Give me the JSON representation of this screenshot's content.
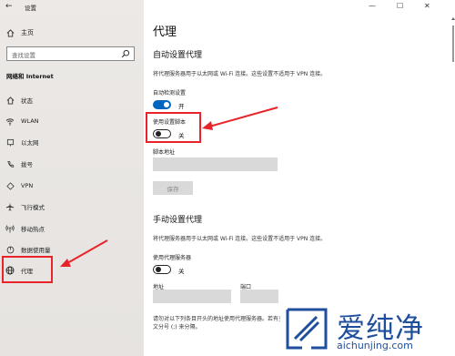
{
  "window": {
    "title": "设置",
    "minimize": "—",
    "maximize": "☐",
    "close": "✕"
  },
  "sidebar": {
    "home": "主页",
    "search_placeholder": "查找设置",
    "section": "网络和 Internet",
    "items": [
      {
        "label": "状态",
        "icon": "status-house-icon"
      },
      {
        "label": "WLAN",
        "icon": "wifi-icon"
      },
      {
        "label": "以太网",
        "icon": "ethernet-icon"
      },
      {
        "label": "拨号",
        "icon": "dialup-phone-icon"
      },
      {
        "label": "VPN",
        "icon": "vpn-icon"
      },
      {
        "label": "飞行模式",
        "icon": "airplane-icon"
      },
      {
        "label": "移动热点",
        "icon": "hotspot-icon"
      },
      {
        "label": "数据使用量",
        "icon": "data-usage-icon"
      },
      {
        "label": "代理",
        "icon": "globe-icon"
      }
    ]
  },
  "main": {
    "title": "代理",
    "auto": {
      "heading": "自动设置代理",
      "desc": "将代理服务器用于以太网或 Wi-Fi 连接。这些设置不适用于 VPN 连接。",
      "detect_label": "自动检测设置",
      "detect_state": "开",
      "script_label": "使用设置脚本",
      "script_state": "关",
      "address_label": "脚本地址",
      "save_label": "保存"
    },
    "manual": {
      "heading": "手动设置代理",
      "desc": "将代理服务器用于以太网或 Wi-Fi 连接。这些设置不适用于 VPN 连接。",
      "proxy_label": "使用代理服务器",
      "proxy_state": "关",
      "address_label": "地址",
      "port_label": "端口",
      "exceptions_desc_line1": "请勿对以下列条目开头的地址使用代理服务器。若有多个条目，请使用英",
      "exceptions_desc_line2": "文分号 (;) 来分隔。"
    }
  },
  "watermark": {
    "brand": "爱纯净",
    "url": "aichunjing.com"
  },
  "colors": {
    "accent": "#0067c0",
    "highlight": "#e8242b",
    "watermark": "#1f4f9c"
  }
}
